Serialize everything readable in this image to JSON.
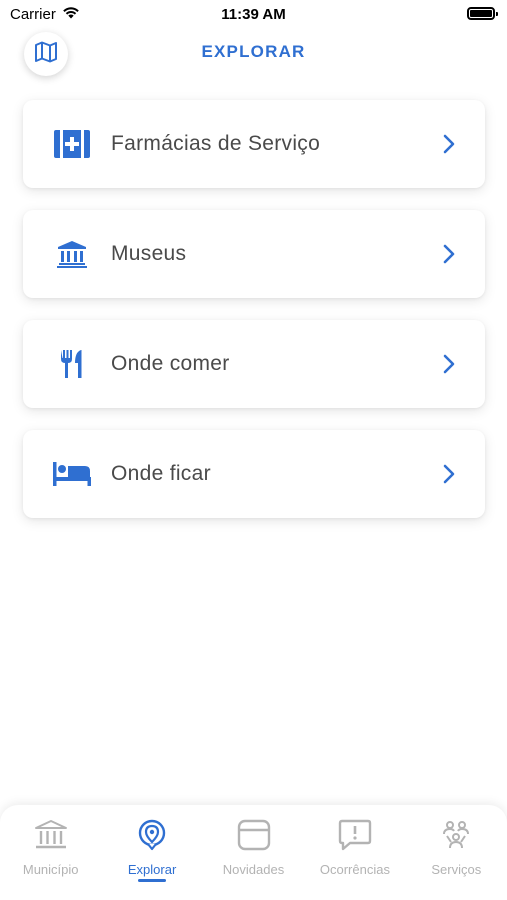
{
  "status": {
    "carrier": "Carrier",
    "time": "11:39 AM"
  },
  "header": {
    "title": "EXPLORAR",
    "map_icon": "map-icon"
  },
  "items": [
    {
      "label": "Farmácias de Serviço",
      "icon": "pharmacy-icon"
    },
    {
      "label": "Museus",
      "icon": "museum-icon"
    },
    {
      "label": "Onde comer",
      "icon": "restaurant-icon"
    },
    {
      "label": "Onde ficar",
      "icon": "hotel-icon"
    }
  ],
  "tabs": [
    {
      "label": "Município",
      "icon": "municipality-icon",
      "active": false
    },
    {
      "label": "Explorar",
      "icon": "location-pin-icon",
      "active": true
    },
    {
      "label": "Novidades",
      "icon": "news-icon",
      "active": false
    },
    {
      "label": "Ocorrências",
      "icon": "alert-chat-icon",
      "active": false
    },
    {
      "label": "Serviços",
      "icon": "services-icon",
      "active": false
    }
  ],
  "colors": {
    "accent": "#2f6fd1",
    "inactive": "#b3b3b3",
    "text": "#4a4a4a"
  }
}
